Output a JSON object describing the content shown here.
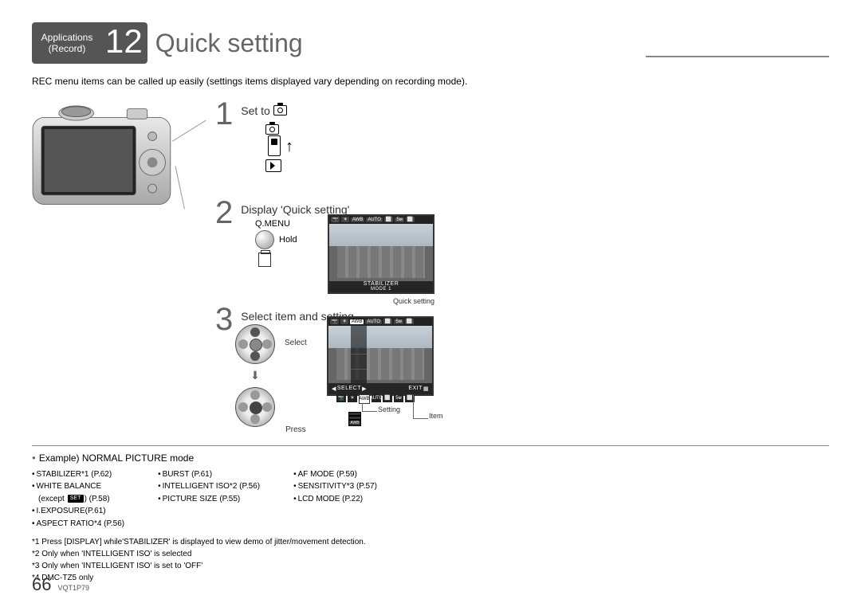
{
  "header": {
    "applications": "Applications",
    "record": "(Record)",
    "chapter_num": "12",
    "title": "Quick setting"
  },
  "intro": "REC menu items can be called up easily (settings items displayed vary depending on recording mode).",
  "steps": {
    "s1": {
      "num": "1",
      "title": "Set to "
    },
    "s2": {
      "num": "2",
      "title": "Display 'Quick setting'",
      "qmenu": "Q.MENU",
      "hold": "Hold",
      "screen_bot": "STABILIZER",
      "screen_mode": "MODE 1",
      "caption": "Quick setting"
    },
    "s3": {
      "num": "3",
      "title": "Select item and setting",
      "select": "Select",
      "press": "Press",
      "screen_sel": "SELECT",
      "screen_exit": "EXIT",
      "setting": "Setting",
      "item": "Item"
    }
  },
  "example_heading": "Example) NORMAL PICTURE mode",
  "columns": {
    "c1": [
      "STABILIZER*1 (P.62)",
      "WHITE BALANCE",
      "(except       ) (P.58)",
      "I.EXPOSURE(P.61)",
      "ASPECT RATIO*4 (P.56)"
    ],
    "c2": [
      "BURST (P.61)",
      "INTELLIGENT ISO*2 (P.56)",
      "PICTURE SIZE (P.55)"
    ],
    "c3": [
      "AF MODE (P.59)",
      "SENSITIVITY*3 (P.57)",
      "LCD MODE (P.22)"
    ]
  },
  "set_label": "SET",
  "footnotes": {
    "f1": "*1 Press [DISPLAY] while'STABILIZER' is displayed to view demo of jitter/movement detection.",
    "f2": "*2 Only when 'INTELLIGENT ISO' is selected",
    "f3": "*3 Only when 'INTELLIGENT ISO' is set to 'OFF'",
    "f4": "*4 DMC-TZ5 only"
  },
  "footer": {
    "page": "66",
    "doc": "VQT1P79"
  }
}
